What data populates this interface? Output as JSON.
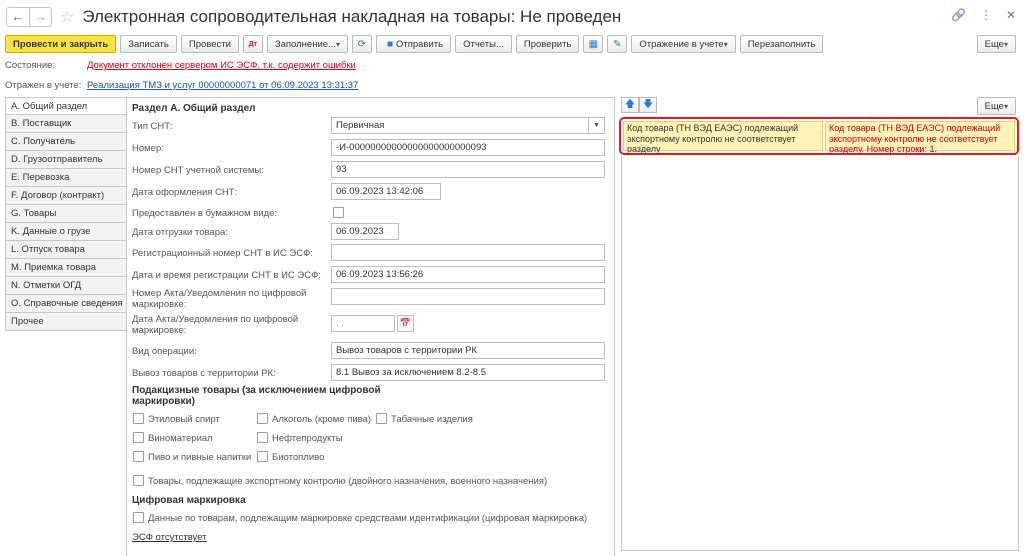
{
  "window": {
    "title": "Электронная сопроводительная накладная на товары: Не проведен"
  },
  "toolbar": {
    "post_close": "Провести и закрыть",
    "write": "Записать",
    "post": "Провести",
    "fill": "Заполнение...",
    "send": "Отправить",
    "reports": "Отчеты...",
    "check": "Проверить",
    "reflect": "Отражение в учете",
    "refill": "Перезаполнить",
    "more": "Еще"
  },
  "status": {
    "state_label": "Состояние:",
    "state_value": "Документ отклонен сервером ИС ЭСФ, т.к. содержит ошибки",
    "reflected_label": "Отражен в учете:",
    "reflected_link": "Реализация ТМЗ и услуг 00000000071 от 06.09.2023 13:31:37"
  },
  "tabs": [
    {
      "label": "А. Общий раздел"
    },
    {
      "label": "B. Поставщик"
    },
    {
      "label": "C. Получатель"
    },
    {
      "label": "D. Грузоотправитель"
    },
    {
      "label": "E. Перевозка"
    },
    {
      "label": "F. Договор (контракт)"
    },
    {
      "label": "G. Товары"
    },
    {
      "label": "K. Данные о грузе"
    },
    {
      "label": "L. Отпуск товара"
    },
    {
      "label": "M. Приемка товара"
    },
    {
      "label": "N. Отметки ОГД"
    },
    {
      "label": "O. Справочные сведения"
    },
    {
      "label": "Прочее"
    }
  ],
  "form": {
    "section_title": "Раздел А. Общий раздел",
    "snt_type_label": "Тип СНТ:",
    "snt_type_value": "Первичная",
    "number_label": "Номер:",
    "number_value": "-И-00000000000000000000000093",
    "acc_number_label": "Номер СНТ учетной системы:",
    "acc_number_value": "93",
    "issue_date_label": "Дата оформления СНТ:",
    "issue_date_value": "06.09.2023 13:42:06",
    "paper_label": "Предоставлен в бумажном виде:",
    "ship_date_label": "Дата отгрузки товара:",
    "ship_date_value": "06.09.2023",
    "reg_number_label": "Регистрационный номер СНТ в ИС ЭСФ:",
    "reg_number_value": "",
    "reg_date_label": "Дата и время регистрации СНТ в ИС ЭСФ:",
    "reg_date_value": "06.09.2023 13:56:26",
    "act_number_label": "Номер Акта/Уведомления по цифровой маркировке:",
    "act_number_value": "",
    "act_date_label": "Дата Акта/Уведомления по цифровой маркировке:",
    "act_date_value": ". .",
    "operation_label": "Вид операции:",
    "operation_value": "Вывоз товаров с территории РК",
    "export_label": "Вывоз товаров с территории РК:",
    "export_value": "8.1 Вывоз за исключением 8.2-8.5",
    "excise_title": "Подакцизные товары (за исключением цифровой маркировки)",
    "excise": {
      "ethyl": "Этиловый спирт",
      "alcohol": "Алкоголь (кроме пива)",
      "tobacco": "Табачные изделия",
      "wine": "Виноматериал",
      "oil": "Нефтепродукты",
      "beer": "Пиво и пивные напитки",
      "biofuel": "Биотопливо"
    },
    "export_control": "Товары, подлежащие экспортному контролю (двойного назначения, военного назначения)",
    "digital_title": "Цифровая маркировка",
    "digital_cb": "Данные по товарам, подлежащим маркировке средствами идентификации (цифровая маркировка)",
    "esf_link": "ЭСФ отсутствует"
  },
  "errors": {
    "field_text": "Код товара (ТН ВЭД ЕАЭС) подлежащий экспортному контролю не соответствует разделу",
    "message_text": "Код товара (ТН ВЭД ЕАЭС) подлежащий экспортному контролю не соответствует разделу. Номер строки: 1."
  },
  "right": {
    "more": "Еще"
  },
  "colors": {
    "primary_button": "#fbe340",
    "error_text": "#d0021b",
    "error_border": "#e01e1e",
    "error_cell_bg": "#fff3b8",
    "link": "#1a53a3"
  }
}
